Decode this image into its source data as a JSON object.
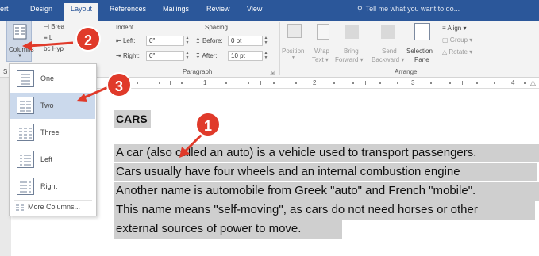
{
  "tabs": [
    {
      "label": "ert"
    },
    {
      "label": "Design"
    },
    {
      "label": "Layout"
    },
    {
      "label": "References"
    },
    {
      "label": "Mailings"
    },
    {
      "label": "Review"
    },
    {
      "label": "View"
    }
  ],
  "tell_me": "Tell me what you want to do...",
  "ribbon": {
    "columns_label": "Columns",
    "breaks_label": "Brea",
    "line_numbers_label": "L",
    "hyphenation_label": "Hyp",
    "indent": {
      "title": "Indent",
      "left_label": "Left:",
      "left_value": "0\"",
      "right_label": "Right:",
      "right_value": "0\""
    },
    "spacing": {
      "title": "Spacing",
      "before_label": "Before:",
      "before_value": "0 pt",
      "after_label": "After:",
      "after_value": "10 pt"
    },
    "paragraph_group": "Paragraph",
    "arrange_group": "Arrange",
    "page_setup_partial": "S",
    "position_label": "Position",
    "wrap_text_label1": "Wrap",
    "wrap_text_label2": "Text",
    "bring_forward_label1": "Bring",
    "bring_forward_label2": "Forward",
    "send_backward_label1": "Send",
    "send_backward_label2": "Backward",
    "selection_pane_label1": "Selection",
    "selection_pane_label2": "Pane",
    "align_label": "Align",
    "group_label": "Group",
    "rotate_label": "Rotate"
  },
  "ruler": {
    "numbers": [
      "1",
      "2",
      "3",
      "4"
    ]
  },
  "columns_menu": {
    "items": [
      {
        "label": "One"
      },
      {
        "label": "Two"
      },
      {
        "label": "Three"
      },
      {
        "label": "Left"
      },
      {
        "label": "Right"
      }
    ],
    "more": "More Columns..."
  },
  "document": {
    "title": "CARS",
    "lines": [
      "A car (also called an auto) is a vehicle used to transport passengers.",
      "Cars usually have four wheels and an internal combustion engine",
      "Another name is automobile from Greek \"auto\" and French \"mobile\".",
      "This name means \"self-moving\", as cars do not need horses or other",
      "external sources of power to move."
    ]
  },
  "badges": {
    "one": "1",
    "two": "2",
    "three": "3"
  },
  "colors": {
    "brand": "#2b579a",
    "badge": "#e03a2a",
    "selection": "#cbd9ec",
    "highlight": "#cfcfcf"
  }
}
